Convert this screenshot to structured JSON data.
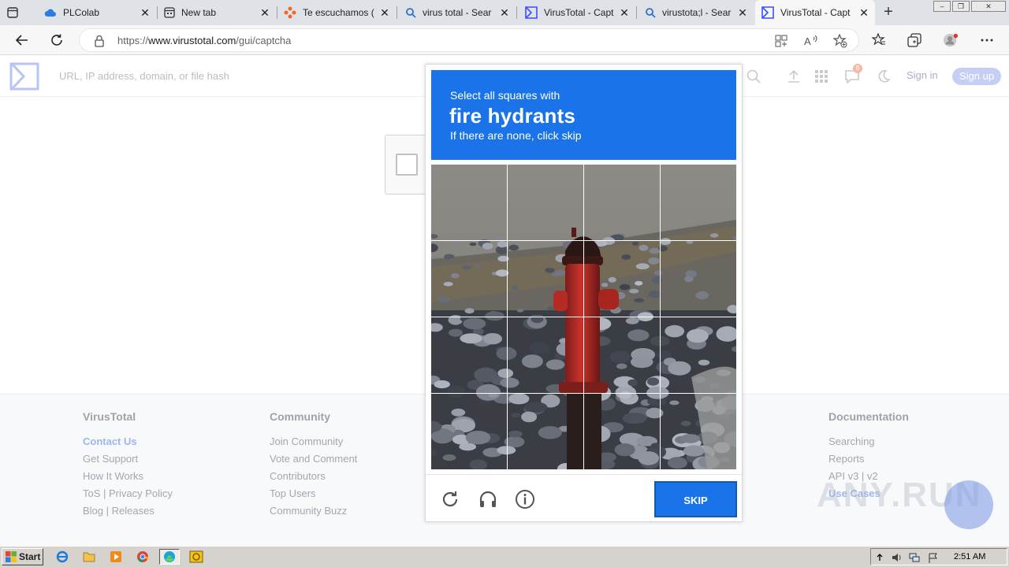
{
  "browser": {
    "tabs": [
      {
        "title": "PLColab",
        "icon": "cloud-icon",
        "active": false
      },
      {
        "title": "New tab",
        "icon": "new-tab-page-icon",
        "active": false
      },
      {
        "title": "Te escuchamos (",
        "icon": "feedback-icon",
        "active": false
      },
      {
        "title": "virus total - Sear",
        "icon": "search-icon",
        "active": false
      },
      {
        "title": "VirusTotal - Capt",
        "icon": "virustotal-icon",
        "active": false
      },
      {
        "title": "virustota;l - Sear",
        "icon": "search-icon",
        "active": false
      },
      {
        "title": "VirusTotal - Capt",
        "icon": "virustotal-icon",
        "active": true
      }
    ],
    "url_prefix": "https://",
    "url_domain": "www.virustotal.com",
    "url_path": "/gui/captcha"
  },
  "vt": {
    "search_placeholder": "URL, IP address, domain, or file hash",
    "notification_count": "8",
    "signin_label": "Sign in",
    "signup_label": "Sign up",
    "brand_color": "#394eff"
  },
  "captcha": {
    "prompt_line1": "Select all squares with",
    "prompt_target": "fire hydrants",
    "prompt_line3": "If there are none, click skip",
    "skip_label": "SKIP",
    "grid_rows": 4,
    "grid_cols": 4,
    "accent_color": "#1a73e8"
  },
  "footer": {
    "columns": [
      {
        "heading": "VirusTotal",
        "links": [
          "Contact Us",
          "Get Support",
          "How It Works",
          "ToS | Privacy Policy",
          "Blog | Releases"
        ]
      },
      {
        "heading": "Community",
        "links": [
          "Join Community",
          "Vote and Comment",
          "Contributors",
          "Top Users",
          "Community Buzz"
        ]
      },
      {
        "heading": "Documentation",
        "links": [
          "Searching",
          "Reports",
          "API v3 | v2",
          "Use Cases"
        ]
      }
    ]
  },
  "watermark": {
    "text": "ANY.RUN"
  },
  "taskbar": {
    "start_label": "Start",
    "clock": "2:51 AM",
    "apps": [
      "ie-icon",
      "folder-icon",
      "media-player-icon",
      "chrome-icon",
      "edge-icon",
      "norton-icon"
    ]
  }
}
